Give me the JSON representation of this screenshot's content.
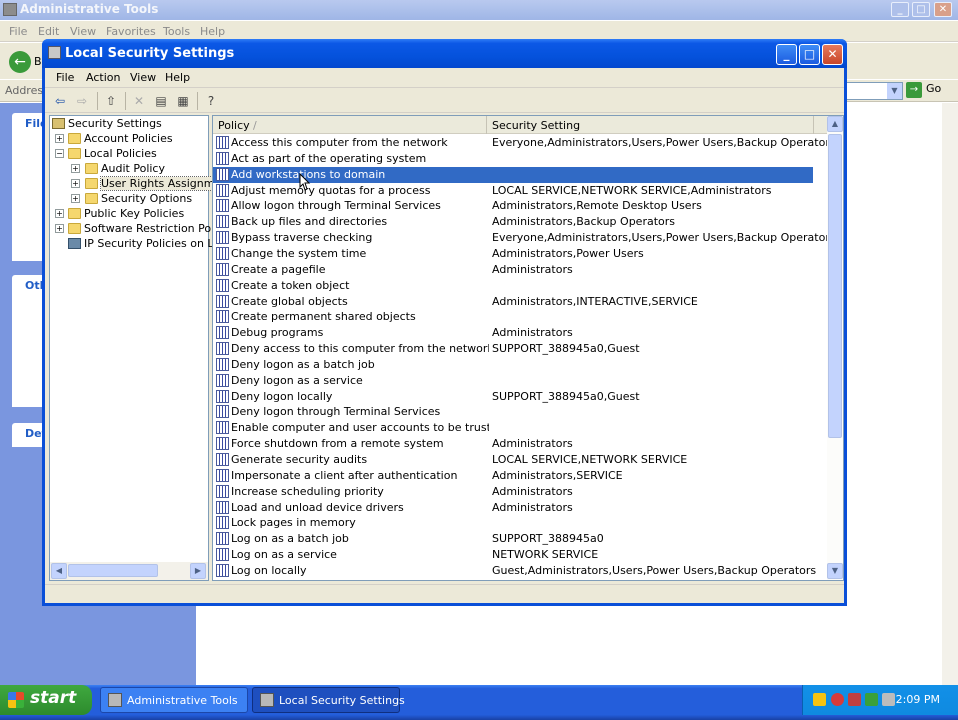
{
  "background_window": {
    "title": "Administrative Tools",
    "menu": [
      "File",
      "Edit",
      "View",
      "Favorites",
      "Tools",
      "Help"
    ],
    "back_label": "B",
    "address_label": "Address",
    "go_label": "Go",
    "panel_labels": [
      "File",
      "Oth",
      "Det"
    ]
  },
  "dialog": {
    "title": "Local Security Settings",
    "menu": [
      "File",
      "Action",
      "View",
      "Help"
    ],
    "tree": [
      {
        "label": "Security Settings"
      },
      {
        "label": "Account Policies"
      },
      {
        "label": "Local Policies"
      },
      {
        "label": "Audit Policy"
      },
      {
        "label": "User Rights Assignmen"
      },
      {
        "label": "Security Options"
      },
      {
        "label": "Public Key Policies"
      },
      {
        "label": "Software Restriction Policie"
      },
      {
        "label": "IP Security Policies on Loca"
      }
    ],
    "columns": {
      "policy": "Policy",
      "sort_indicator": "/",
      "setting": "Security Setting"
    },
    "rows": [
      {
        "policy": "Access this computer from the network",
        "setting": "Everyone,Administrators,Users,Power Users,Backup Operators"
      },
      {
        "policy": "Act as part of the operating system",
        "setting": ""
      },
      {
        "policy": "Add workstations to domain",
        "setting": "",
        "selected": true
      },
      {
        "policy": "Adjust memory quotas for a process",
        "setting": "LOCAL SERVICE,NETWORK SERVICE,Administrators"
      },
      {
        "policy": "Allow logon through Terminal Services",
        "setting": "Administrators,Remote Desktop Users"
      },
      {
        "policy": "Back up files and directories",
        "setting": "Administrators,Backup Operators"
      },
      {
        "policy": "Bypass traverse checking",
        "setting": "Everyone,Administrators,Users,Power Users,Backup Operators"
      },
      {
        "policy": "Change the system time",
        "setting": "Administrators,Power Users"
      },
      {
        "policy": "Create a pagefile",
        "setting": "Administrators"
      },
      {
        "policy": "Create a token object",
        "setting": ""
      },
      {
        "policy": "Create global objects",
        "setting": "Administrators,INTERACTIVE,SERVICE"
      },
      {
        "policy": "Create permanent shared objects",
        "setting": ""
      },
      {
        "policy": "Debug programs",
        "setting": "Administrators"
      },
      {
        "policy": "Deny access to this computer from the network",
        "setting": "SUPPORT_388945a0,Guest"
      },
      {
        "policy": "Deny logon as a batch job",
        "setting": ""
      },
      {
        "policy": "Deny logon as a service",
        "setting": ""
      },
      {
        "policy": "Deny logon locally",
        "setting": "SUPPORT_388945a0,Guest"
      },
      {
        "policy": "Deny logon through Terminal Services",
        "setting": ""
      },
      {
        "policy": "Enable computer and user accounts to be trusted for ...",
        "setting": ""
      },
      {
        "policy": "Force shutdown from a remote system",
        "setting": "Administrators"
      },
      {
        "policy": "Generate security audits",
        "setting": "LOCAL SERVICE,NETWORK SERVICE"
      },
      {
        "policy": "Impersonate a client after authentication",
        "setting": "Administrators,SERVICE"
      },
      {
        "policy": "Increase scheduling priority",
        "setting": "Administrators"
      },
      {
        "policy": "Load and unload device drivers",
        "setting": "Administrators"
      },
      {
        "policy": "Lock pages in memory",
        "setting": ""
      },
      {
        "policy": "Log on as a batch job",
        "setting": "SUPPORT_388945a0"
      },
      {
        "policy": "Log on as a service",
        "setting": "NETWORK SERVICE"
      },
      {
        "policy": "Log on locally",
        "setting": "Guest,Administrators,Users,Power Users,Backup Operators"
      }
    ]
  },
  "taskbar": {
    "start_label": "start",
    "tasks": [
      "Administrative Tools",
      "Local Security Settings"
    ],
    "clock": "2:09 PM"
  },
  "colors": {
    "selection": "#316ac5",
    "title_blue": "#0552dc",
    "taskbar_blue": "#245edb",
    "start_green": "#3a9a3a"
  }
}
